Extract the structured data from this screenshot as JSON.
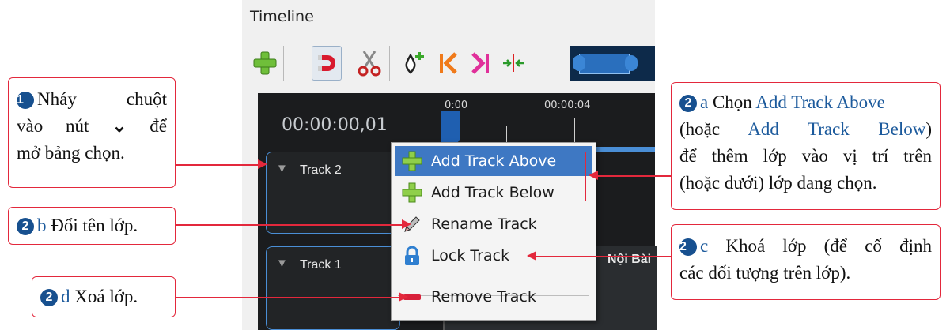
{
  "panel": {
    "title": "Timeline"
  },
  "toolbar": {
    "buttons": [
      "add-track",
      "snap",
      "razor",
      "add-marker",
      "previous-marker",
      "next-marker",
      "center-playhead"
    ]
  },
  "timeline": {
    "timecode": "00:00:00,01",
    "ruler": [
      "0:00",
      "00:00:04"
    ],
    "tracks": [
      {
        "name": "Track 2"
      },
      {
        "name": "Track 1"
      }
    ],
    "clip_label": "Nội Bài"
  },
  "menu": {
    "items": [
      {
        "label": "Add Track Above",
        "icon": "plus-icon",
        "selected": true
      },
      {
        "label": "Add Track Below",
        "icon": "plus-icon",
        "selected": false
      },
      {
        "label": "Rename Track",
        "icon": "pencil-icon",
        "selected": false
      },
      {
        "label": "Lock Track",
        "icon": "lock-icon",
        "selected": false
      },
      {
        "label": "Remove Track",
        "icon": "minus-icon",
        "selected": false
      }
    ]
  },
  "annotations": {
    "a1": {
      "num": "1",
      "l1a": "Nháy",
      "l1b": "chuột",
      "l2a": "vào",
      "l2b": "nút",
      "chev": "⌄",
      "l2c": "để",
      "l3": "mở bảng chọn."
    },
    "a2a": {
      "num": "2",
      "tag": "a",
      "p1": "Chọn ",
      "link1": "Add Track Above",
      "p2": "(hoặc ",
      "link2": "Add Track Below",
      "p3": ")",
      "l3": "để thêm lớp vào vị trí trên",
      "l4": "(hoặc dưới) lớp đang chọn."
    },
    "a2b": {
      "num": "2",
      "tag": "b",
      "text": " Đổi tên lớp."
    },
    "a2c": {
      "num": "2",
      "tag": "c",
      "l1": " Khoá lớp (để cố định",
      "l2": "các đối tượng trên lớp)."
    },
    "a2d": {
      "num": "2",
      "tag": "d",
      "text": " Xoá lớp."
    }
  },
  "colors": {
    "accent": "#e3283c",
    "number_badge": "#17508f",
    "link": "#1c5a9c",
    "menu_selected": "#3e78c3"
  }
}
